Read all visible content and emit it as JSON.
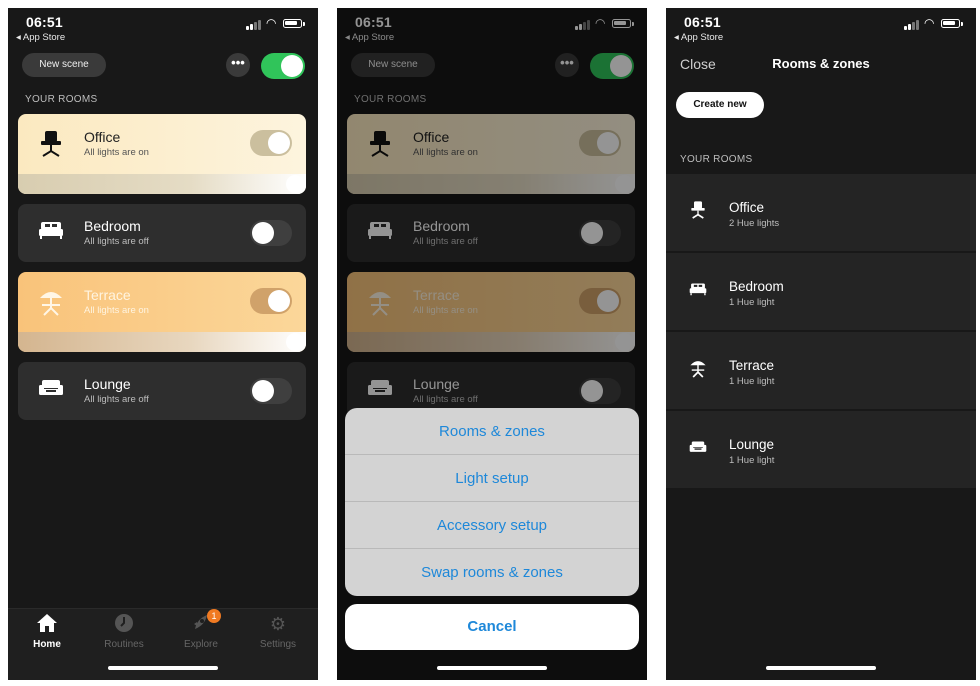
{
  "status": {
    "time": "06:51",
    "back_link": "◂ App Store"
  },
  "home": {
    "new_scene": "New scene",
    "more": "•••",
    "section_label": "YOUR ROOMS",
    "rooms": [
      {
        "name": "Office",
        "status": "All lights are on",
        "on": true
      },
      {
        "name": "Bedroom",
        "status": "All lights are off",
        "on": false
      },
      {
        "name": "Terrace",
        "status": "All lights are on",
        "on": true
      },
      {
        "name": "Lounge",
        "status": "All lights are off",
        "on": false
      }
    ],
    "tabs": [
      {
        "label": "Home",
        "icon": "home-icon",
        "active": true
      },
      {
        "label": "Routines",
        "icon": "clock-icon",
        "active": false
      },
      {
        "label": "Explore",
        "icon": "rocket-icon",
        "active": false,
        "badge": "1"
      },
      {
        "label": "Settings",
        "icon": "gear-icon",
        "active": false
      }
    ]
  },
  "action_sheet": {
    "items": [
      "Rooms & zones",
      "Light setup",
      "Accessory setup",
      "Swap rooms & zones"
    ],
    "cancel": "Cancel"
  },
  "rooms_zones": {
    "close": "Close",
    "title": "Rooms & zones",
    "create_new": "Create new",
    "section_label": "YOUR ROOMS",
    "rooms": [
      {
        "name": "Office",
        "count": "2 Hue lights"
      },
      {
        "name": "Bedroom",
        "count": "1 Hue light"
      },
      {
        "name": "Terrace",
        "count": "1 Hue light"
      },
      {
        "name": "Lounge",
        "count": "1 Hue light"
      }
    ]
  },
  "colors": {
    "accent_green": "#30c45a",
    "link_blue": "#1e88d9",
    "office_warm": "#fbe9c0",
    "terrace_warm": "#f9c37a",
    "badge_orange": "#f07a22"
  }
}
